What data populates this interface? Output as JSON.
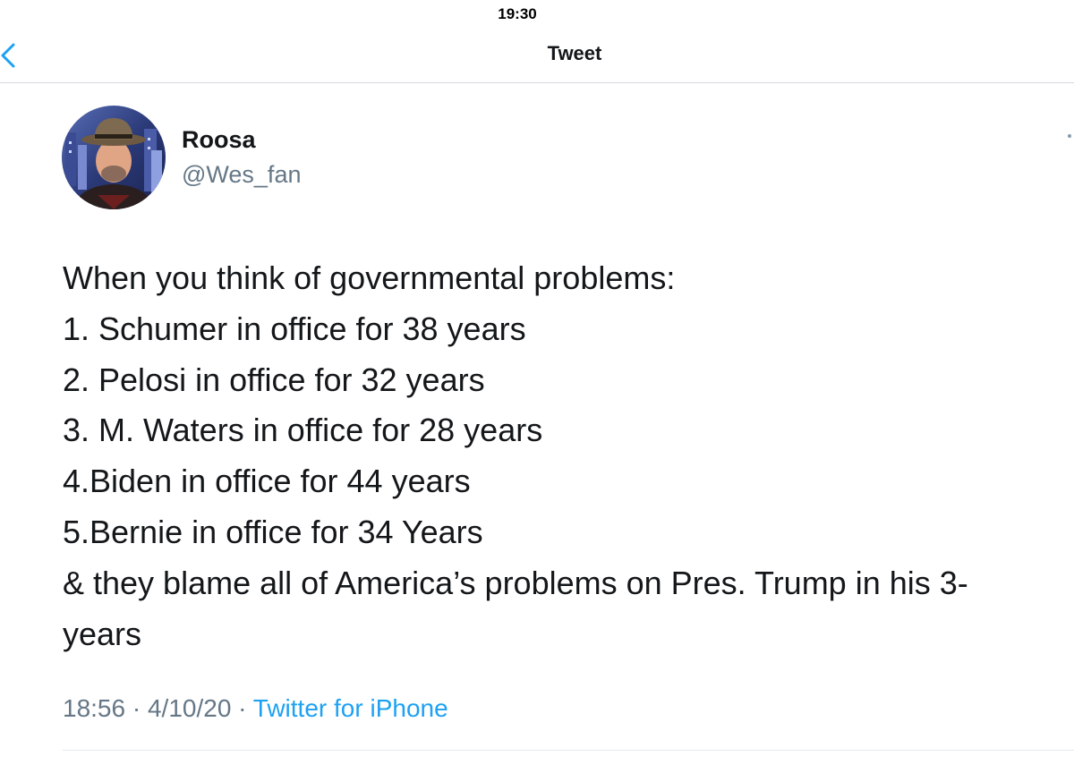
{
  "status_bar": {
    "time": "19:30"
  },
  "nav": {
    "title": "Tweet",
    "back_icon": "chevron-left-icon",
    "accent_color": "#1da1f2"
  },
  "author": {
    "name": "Roosa",
    "handle": "@Wes_fan",
    "avatar_icon": "avatar-photo"
  },
  "tweet": {
    "lines": [
      "When you think of governmental problems:",
      "1. Schumer in office for 38 years",
      "2. Pelosi in office for 32 years",
      "3. M. Waters in office for 28 years",
      "4.Biden in office for 44 years",
      "5.Bernie in office for 34 Years",
      "& they blame all of America’s problems on Pres. Trump in his 3-",
      "years"
    ],
    "time": "18:56",
    "separator": " · ",
    "date": "4/10/20",
    "source": "Twitter for iPhone"
  },
  "colors": {
    "text": "#14171a",
    "secondary_text": "#657786",
    "link": "#1da1f2",
    "divider": "#e1e8ed"
  }
}
